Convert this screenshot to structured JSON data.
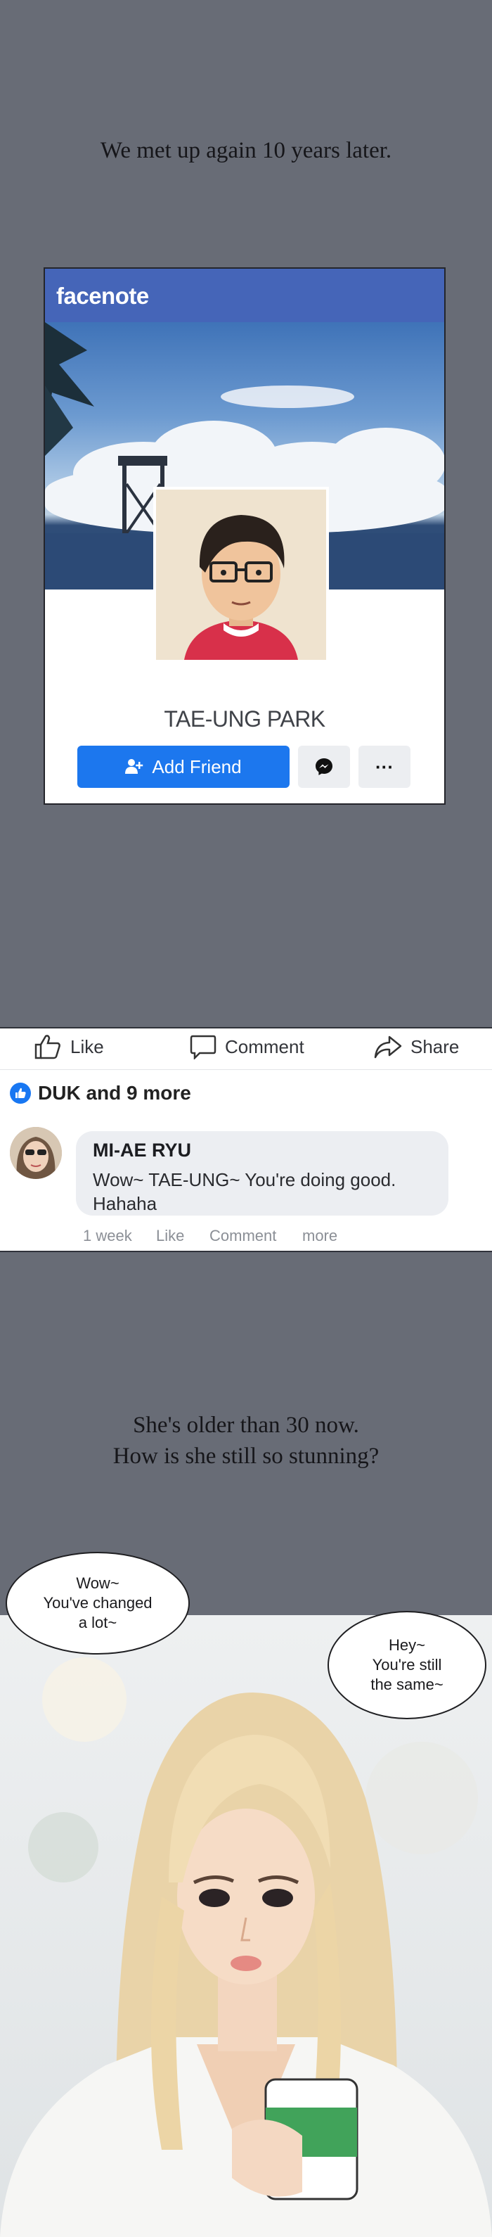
{
  "caption_top": "We met up again 10 years later.",
  "profile": {
    "brand": "facenote",
    "name": "TAE-UNG PARK",
    "add_friend": "Add Friend",
    "more_glyph": "···",
    "messenger_icon": "messenger-icon",
    "add_friend_icon": "add-person-icon"
  },
  "post": {
    "actions": {
      "like": "Like",
      "comment": "Comment",
      "share": "Share"
    },
    "likes": "DUK and 9 more",
    "comment": {
      "author": "MI-AE RYU",
      "line1": "Wow~ TAE-UNG~ You're doing good.",
      "line2": "Hahaha"
    },
    "meta": {
      "time": "1 week",
      "like": "Like",
      "comment": "Comment",
      "more": "more"
    }
  },
  "caption_mid": {
    "line1": "She's older than 30 now.",
    "line2": "How is she still so stunning?"
  },
  "speech_left": {
    "line1": "Wow~",
    "line2": "You've changed",
    "line3": "a lot~"
  },
  "speech_right": {
    "line1": "Hey~",
    "line2": "You're still",
    "line3": "the same~"
  },
  "colors": {
    "background": "#686c76",
    "brand_blue": "#4565b8",
    "button_blue": "#1c77ee"
  }
}
